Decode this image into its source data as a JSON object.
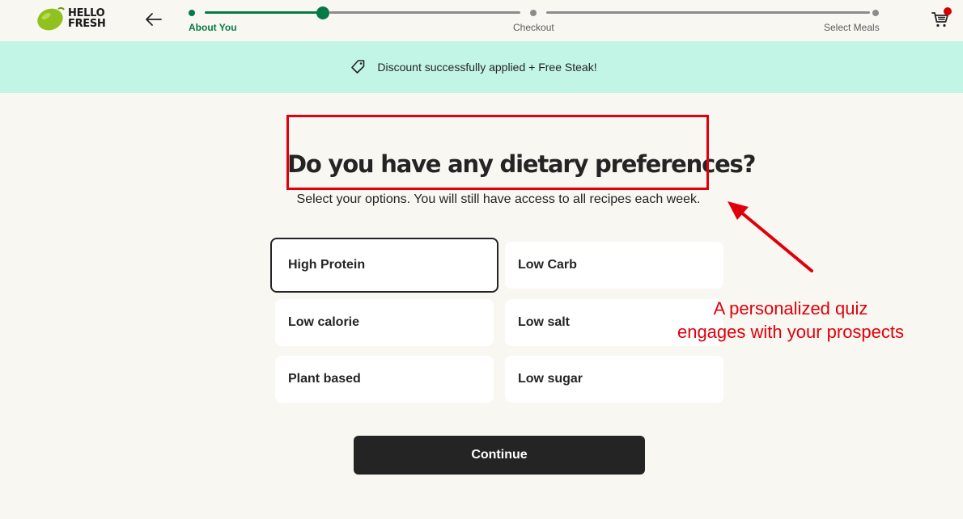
{
  "header": {
    "logo_text_line1": "HELLO",
    "logo_text_line2": "FRESH",
    "steps": [
      {
        "label": "About You",
        "state": "active"
      },
      {
        "label": "Checkout",
        "state": "upcoming"
      },
      {
        "label": "Select Meals",
        "state": "upcoming"
      }
    ],
    "progress_fraction": 0.19
  },
  "banner": {
    "text": "Discount successfully applied + Free Steak!"
  },
  "main": {
    "title": "Do you have any dietary preferences?",
    "subtitle": "Select your options. You will still have access to all recipes each week.",
    "options": [
      {
        "label": "High Protein",
        "selected": true
      },
      {
        "label": "Low Carb",
        "selected": false
      },
      {
        "label": "Low calorie",
        "selected": false
      },
      {
        "label": "Low salt",
        "selected": false
      },
      {
        "label": "Plant based",
        "selected": false
      },
      {
        "label": "Low sugar",
        "selected": false
      }
    ],
    "continue_label": "Continue"
  },
  "annotation": {
    "text_line1": "A personalized quiz",
    "text_line2": "engages with your prospects"
  },
  "colors": {
    "brand_green": "#067a46",
    "lime": "#91c11e",
    "banner_bg": "#c3f5e6",
    "annotation_red": "#e0000b",
    "page_bg": "#f9f7f2",
    "button_dark": "#242424"
  },
  "icons": [
    "lime-logo-icon",
    "back-arrow-icon",
    "cart-icon",
    "tag-icon"
  ]
}
